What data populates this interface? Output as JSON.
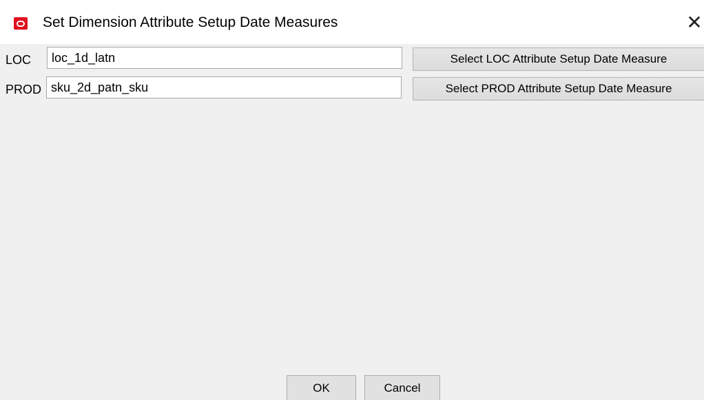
{
  "dialog": {
    "title": "Set Dimension Attribute Setup Date Measures",
    "close_glyph": "✕",
    "icon": "oracle-logo-icon",
    "accent_color": "#e0121f"
  },
  "rows": [
    {
      "label": "LOC",
      "value": "loc_1d_latn",
      "button_label": "Select LOC Attribute Setup Date Measure"
    },
    {
      "label": "PROD",
      "value": "sku_2d_patn_sku",
      "button_label": "Select PROD Attribute Setup Date Measure"
    }
  ],
  "footer": {
    "ok_label": "OK",
    "cancel_label": "Cancel"
  }
}
